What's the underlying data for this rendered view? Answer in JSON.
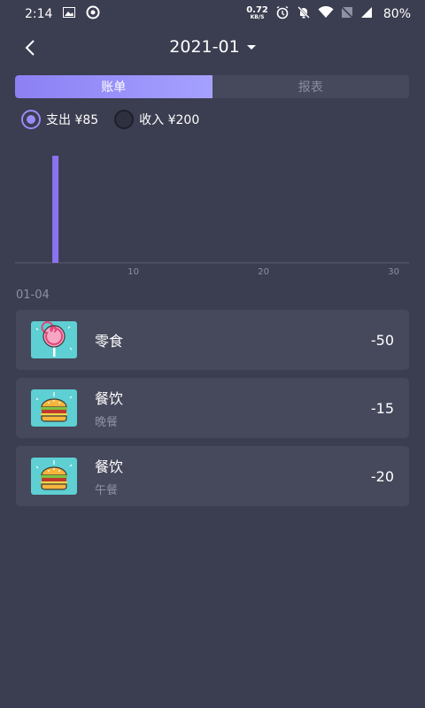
{
  "status_bar": {
    "time": "2:14",
    "net_speed_value": "0.72",
    "net_speed_unit": "KB/S",
    "battery": "80%",
    "icons": [
      "image-icon",
      "hotspot-icon",
      "alarm-icon",
      "mute-icon",
      "wifi-icon",
      "sim-off-icon",
      "signal-icon"
    ]
  },
  "header": {
    "back_icon": "chevron-left-icon",
    "month": "2021-01"
  },
  "tabs": [
    {
      "label": "账单",
      "active": true
    },
    {
      "label": "报表",
      "active": false
    }
  ],
  "type_filter": {
    "expense_label": "支出 ¥85",
    "income_label": "收入 ¥200",
    "selected": "expense"
  },
  "chart_data": {
    "type": "bar",
    "x": [
      4
    ],
    "values": [
      85
    ],
    "xlim": [
      1,
      31
    ],
    "xticks": [
      "10",
      "20",
      "30"
    ],
    "title": "",
    "xlabel": "",
    "ylabel": "",
    "color": "#8b73f0",
    "grid": false
  },
  "date_group": "01-04",
  "records": [
    {
      "category": "零食",
      "note": "",
      "amount": "-50",
      "icon": "lollipop-icon"
    },
    {
      "category": "餐饮",
      "note": "晚餐",
      "amount": "-15",
      "icon": "burger-icon"
    },
    {
      "category": "餐饮",
      "note": "午餐",
      "amount": "-20",
      "icon": "burger-icon"
    }
  ],
  "colors": {
    "background": "#3b3d50",
    "card": "#46485b",
    "accent": "#9a8bf6",
    "icon_bg": "#5ecfd3"
  }
}
